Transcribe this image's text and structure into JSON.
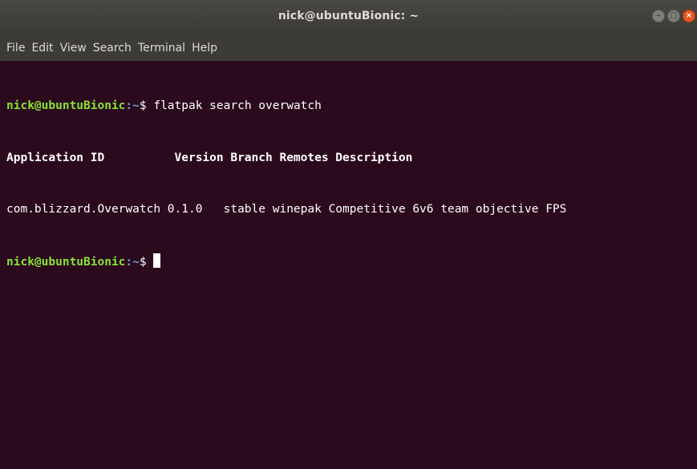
{
  "window": {
    "title": "nick@ubuntuBionic: ~",
    "controls": {
      "minimize": "–",
      "maximize": "□",
      "close": "×"
    }
  },
  "menu": {
    "items": [
      "File",
      "Edit",
      "View",
      "Search",
      "Terminal",
      "Help"
    ]
  },
  "terminal": {
    "prompt_user": "nick@ubuntuBionic",
    "prompt_sep": ":",
    "prompt_path": "~",
    "prompt_symbol": "$ ",
    "command": "flatpak search overwatch",
    "header": "Application ID          Version Branch Remotes Description",
    "result_row": "com.blizzard.Overwatch 0.1.0   stable winepak Competitive 6v6 team objective FPS",
    "colors": {
      "background": "#2c0a1e",
      "text": "#ffffff",
      "prompt_user": "#8ae234",
      "prompt_path": "#729fcf"
    }
  }
}
